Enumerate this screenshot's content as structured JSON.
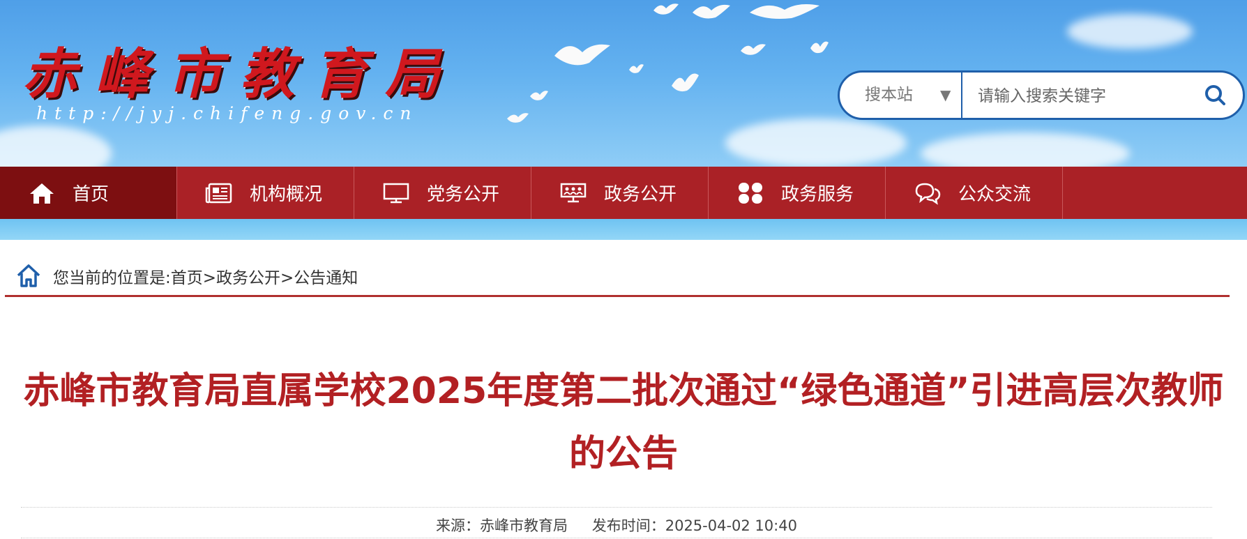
{
  "header": {
    "logo_title": "赤峰市教育局",
    "logo_url": "http://jyj.chifeng.gov.cn"
  },
  "search": {
    "scope": "搜本站",
    "placeholder": "请输入搜索关键字"
  },
  "nav": {
    "items": [
      {
        "label": "首页",
        "icon": "home-icon"
      },
      {
        "label": "机构概况",
        "icon": "newspaper-icon"
      },
      {
        "label": "党务公开",
        "icon": "monitor-icon"
      },
      {
        "label": "政务公开",
        "icon": "presentation-icon"
      },
      {
        "label": "政务服务",
        "icon": "grid-icon"
      },
      {
        "label": "公众交流",
        "icon": "chat-icon"
      }
    ]
  },
  "breadcrumb": {
    "text": "您当前的位置是:首页>政务公开>公告通知"
  },
  "article": {
    "title": "赤峰市教育局直属学校2025年度第二批次通过“绿色通道”引进高层次教师的公告",
    "source": "来源：赤峰市教育局",
    "published": "发布时间：2025-04-02 10:40"
  },
  "colors": {
    "nav_bg": "#aa2126",
    "nav_active": "#7d0f11",
    "title_red": "#b22023",
    "search_border": "#1f5faa"
  }
}
